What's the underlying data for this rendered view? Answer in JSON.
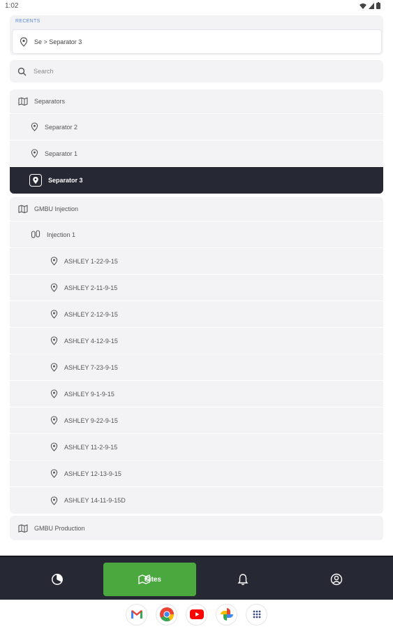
{
  "status_bar": {
    "time": "1:02"
  },
  "recents": {
    "label": "RECENTS",
    "item": "Se > Separator 3"
  },
  "search": {
    "placeholder": "Search"
  },
  "groups": {
    "separators": {
      "label": "Separators",
      "items": [
        "Separator 2",
        "Separator 1",
        "Separator 3"
      ],
      "selected": "Separator 3"
    },
    "injection": {
      "label": "GMBU Injection",
      "subgroup": "Injection 1",
      "items": [
        "ASHLEY 1-22-9-15",
        "ASHLEY 2-11-9-15",
        "ASHLEY 2-12-9-15",
        "ASHLEY 4-12-9-15",
        "ASHLEY 7-23-9-15",
        "ASHLEY 9-1-9-15",
        "ASHLEY 9-22-9-15",
        "ASHLEY 11-2-9-15",
        "ASHLEY 12-13-9-15",
        "ASHLEY 14-11-9-15D"
      ]
    },
    "production": {
      "label": "GMBU Production"
    }
  },
  "nav": {
    "items": [
      {
        "icon": "dashboard-icon"
      },
      {
        "icon": "sites-icon",
        "label": "Sites",
        "active": true
      },
      {
        "icon": "bell-icon"
      },
      {
        "icon": "profile-icon"
      }
    ],
    "active_color": "#4aa83f",
    "bar_color": "#262833"
  },
  "dock": {
    "apps": [
      "gmail-icon",
      "chrome-icon",
      "youtube-icon",
      "photos-icon",
      "app-drawer-icon"
    ]
  }
}
